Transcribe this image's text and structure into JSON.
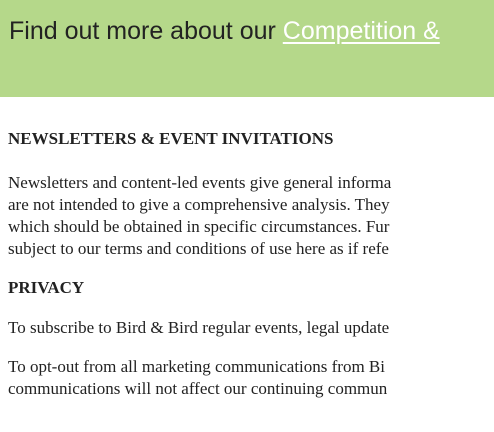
{
  "banner": {
    "prefix": "Find out more about our ",
    "link_text": "Competition & ",
    "bg_color": "#b5d88a",
    "link_color": "#ffffff"
  },
  "newsletters": {
    "heading": "NEWSLETTERS & EVENT INVITATIONS",
    "lines": [
      "Newsletters and content-led events give general informa",
      "are not intended to give a comprehensive analysis. They",
      "which should be obtained in specific circumstances. Fur",
      "subject to our terms and conditions of use here as if refe"
    ]
  },
  "privacy": {
    "heading": "PRIVACY",
    "subscribe_line": "To subscribe to Bird & Bird regular events, legal update",
    "optout_lines": [
      "To opt-out from all marketing communications from Bi",
      "communications will not affect our continuing commun"
    ]
  }
}
